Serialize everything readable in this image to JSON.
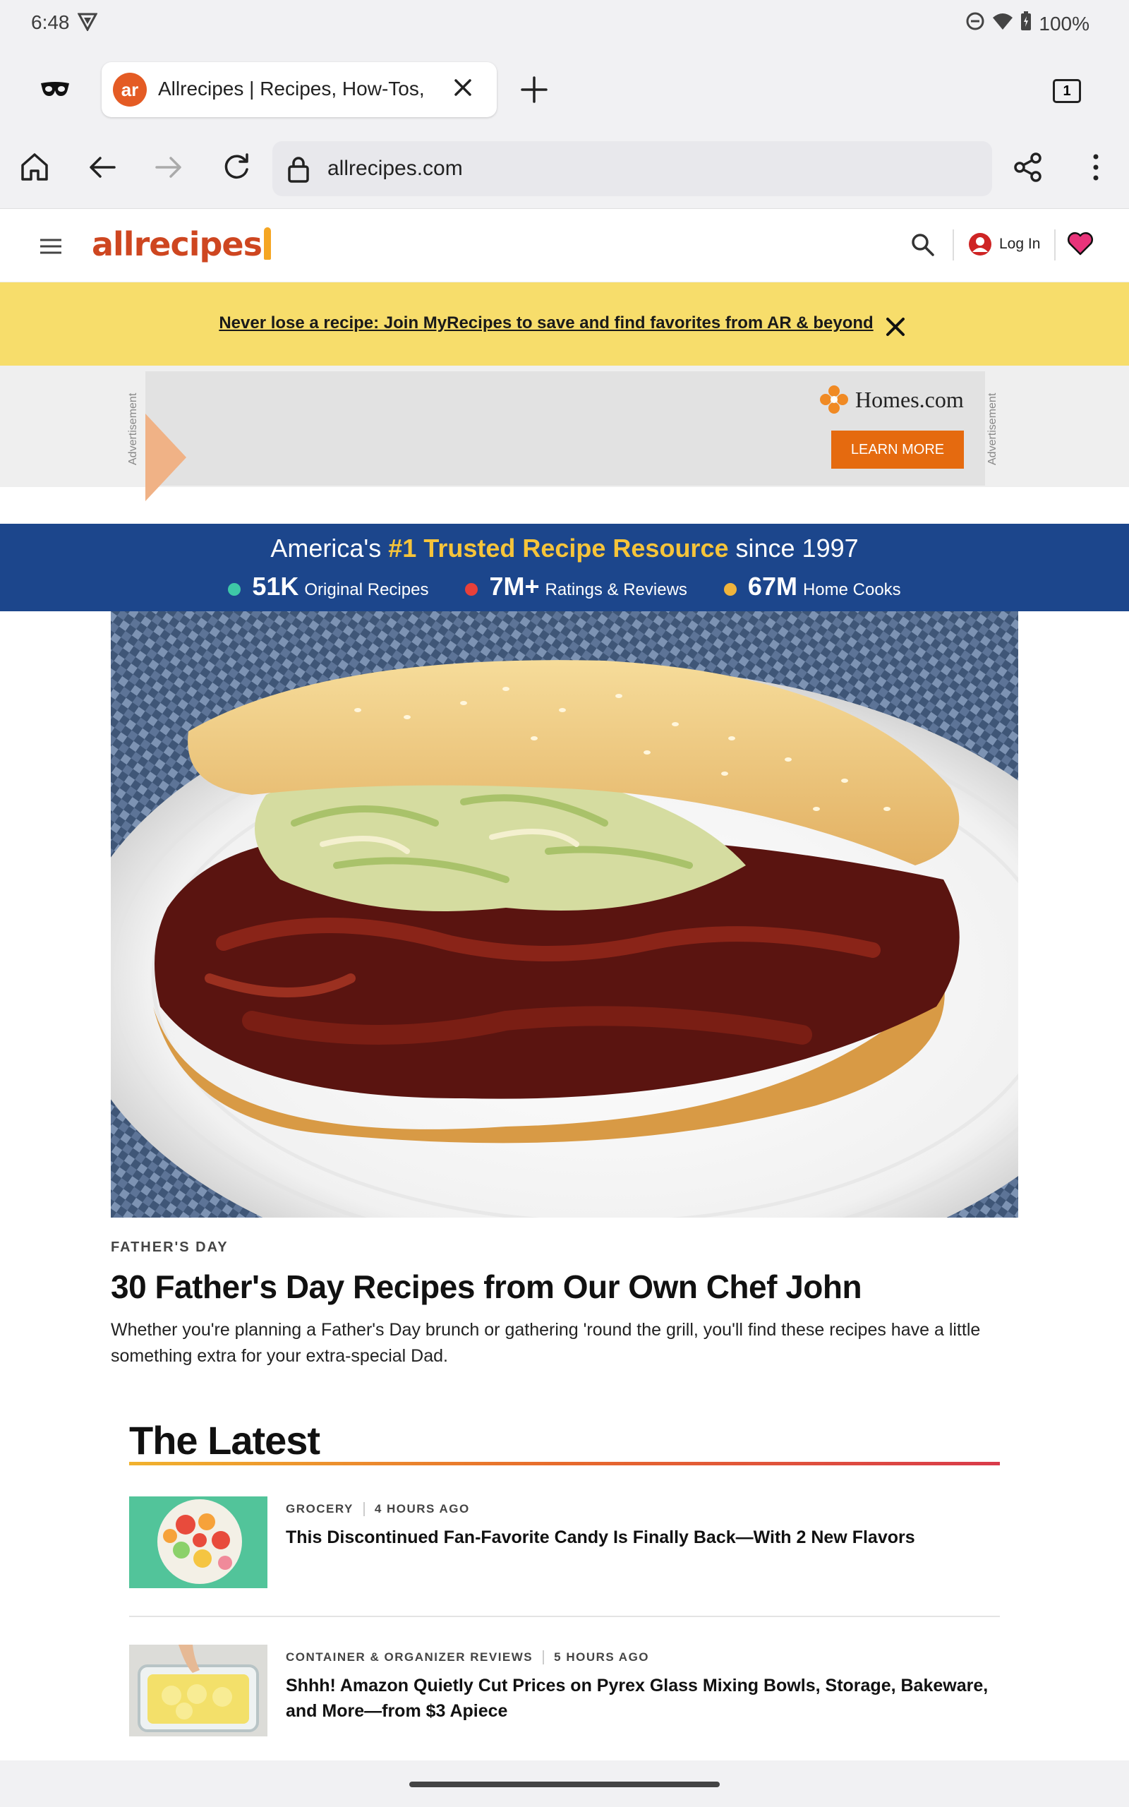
{
  "status_bar": {
    "time": "6:48",
    "battery": "100%"
  },
  "browser": {
    "tab": {
      "title": "Allrecipes | Recipes, How-Tos,",
      "favicon_text": "ar"
    },
    "tab_count": "1",
    "url": "allrecipes.com"
  },
  "site_header": {
    "logo_text": "allrecipes",
    "login_label": "Log In"
  },
  "promo_banner": {
    "text": "Never lose a recipe: Join MyRecipes to save and find favorites from AR & beyond"
  },
  "ad": {
    "label": "Advertisement",
    "brand": "Homes.com",
    "cta": "LEARN MORE"
  },
  "stats_band": {
    "tagline_prefix": "America's",
    "tagline_highlight": "#1 Trusted Recipe Resource",
    "tagline_suffix": "since 1997",
    "stats": [
      {
        "number": "51K",
        "label": "Original Recipes",
        "color": "#3ec9a7"
      },
      {
        "number": "7M+",
        "label": "Ratings & Reviews",
        "color": "#e8403a"
      },
      {
        "number": "67M",
        "label": "Home Cooks",
        "color": "#f0b43c"
      }
    ]
  },
  "hero": {
    "kicker": "FATHER'S DAY",
    "headline": "30 Father's Day Recipes from Our Own Chef John",
    "dek": "Whether you're planning a Father's Day brunch or gathering 'round the grill, you'll find these recipes have a little something extra for your extra-special Dad."
  },
  "latest": {
    "title": "The Latest",
    "items": [
      {
        "category": "GROCERY",
        "time": "4 HOURS AGO",
        "title": "This Discontinued Fan-Favorite Candy Is Finally Back—With 2 New Flavors"
      },
      {
        "category": "CONTAINER & ORGANIZER REVIEWS",
        "time": "5 HOURS AGO",
        "title": "Shhh! Amazon Quietly Cut Prices on Pyrex Glass Mixing Bowls, Storage, Bakeware, and More—from $3 Apiece"
      }
    ]
  },
  "colors": {
    "brand": "#ce4620",
    "promo_bg": "#f7dd6b",
    "stats_bg": "#1c468c",
    "highlight": "#f6c43a",
    "ad_cta": "#e56a0f"
  }
}
